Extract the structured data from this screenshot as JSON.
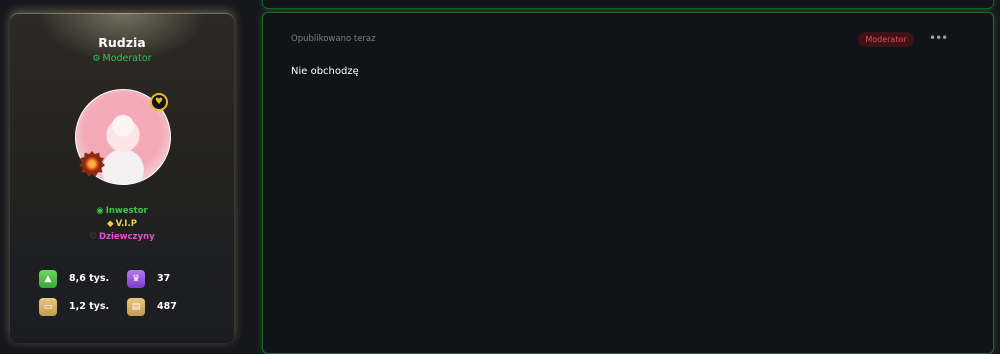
{
  "profile": {
    "username": "Rudzia",
    "role": "Moderator",
    "tags": [
      {
        "label": "Inwestor",
        "icon": "dollar-icon",
        "color": "#3cc84c"
      },
      {
        "label": "V.I.P",
        "icon": "gem-icon",
        "color": "#e9d24a"
      },
      {
        "label": "Dziewczyny",
        "icon": "heart-icon",
        "color": "#e24fd3"
      }
    ],
    "stats": {
      "likes": "8,6 tys.",
      "trophies": "37",
      "messages": "1,2 tys.",
      "files": "487"
    }
  },
  "post": {
    "posted_label": "Opublikowano teraz",
    "badge": "Moderator",
    "menu_glyph": "•••",
    "content": "Nie obchodzę"
  },
  "colors": {
    "accent_green": "#33c24d",
    "moderator_red": "#f0485a",
    "background": "#16171c"
  }
}
